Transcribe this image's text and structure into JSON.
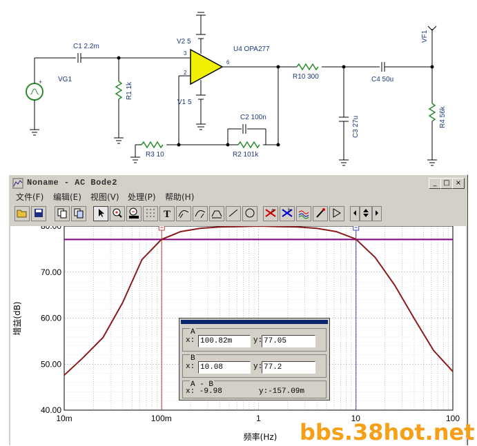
{
  "schematic": {
    "labels": {
      "vg1": "VG1",
      "c1": "C1 2.2m",
      "r1": "R1 1k",
      "v2": "V2 5",
      "v1": "V1 5",
      "u4": "U4 OPA277",
      "pin3": "3",
      "pin2": "2",
      "pin6": "6",
      "c2": "C2 100n",
      "r2": "R2 101k",
      "r3": "R3 10",
      "r10": "R10 300",
      "c3": "C3 27u",
      "c4": "C4 50u",
      "r4": "R4 56k",
      "vf1": "VF1",
      "plus": "+"
    }
  },
  "window": {
    "title": "Noname - AC Bode2",
    "buttons": {
      "minimize": "_",
      "maximize": "□",
      "close": "×"
    },
    "menus": [
      "文件(F)",
      "编辑(E)",
      "视图(V)",
      "处理(P)",
      "帮助(H)"
    ]
  },
  "toolbar": {
    "tools": [
      "open",
      "save",
      "copy",
      "copy-special",
      "pointer",
      "zoom-in",
      "zoom-100",
      "grid",
      "text",
      "cursor-a",
      "cursor-b",
      "marker",
      "line",
      "circle",
      "cursor-a-x",
      "cursor-b-x",
      "curves",
      "pen",
      "flag",
      "arrow-left",
      "arrow-updown",
      "arrow-right"
    ]
  },
  "cursor_box": {
    "group_a": "A",
    "group_b": "B",
    "group_ab": "A - B",
    "x_label": "x:",
    "y_label": "y:",
    "a_x": "100.82m",
    "a_y": "77.05",
    "b_x": "10.08",
    "b_y": "77.2",
    "ab_x": "x: -9.98",
    "ab_y": "y:-157.09m"
  },
  "chart_data": {
    "type": "line",
    "xlabel": "频率(Hz)",
    "ylabel": "增益(dB)",
    "xscale": "log",
    "xlim": [
      0.01,
      100
    ],
    "ylim": [
      40,
      80
    ],
    "x_ticks": [
      "10m",
      "100m",
      "1",
      "10",
      "100"
    ],
    "y_ticks": [
      "80.00",
      "70.00",
      "60.00",
      "50.00",
      "40.00"
    ],
    "grid": true,
    "cursor_a": {
      "x": 0.1008,
      "y": 77.05
    },
    "cursor_b": {
      "x": 10.08,
      "y": 77.2
    },
    "hline_y": 77.1,
    "curve_color": "#8b1a1a",
    "series": [
      {
        "x": [
          0.01,
          0.0158,
          0.0251,
          0.0398,
          0.0631,
          0.1,
          0.158,
          0.251,
          0.398,
          0.631,
          1,
          1.585,
          2.512,
          3.981,
          6.31,
          10,
          15.85,
          25.12,
          39.81,
          63.1,
          100
        ],
        "values": [
          47.6,
          51.5,
          55.8,
          63.3,
          72.7,
          77.1,
          78.8,
          79.5,
          79.8,
          79.9,
          80.0,
          79.9,
          79.8,
          79.5,
          78.8,
          77.2,
          73.2,
          67.2,
          60.0,
          53.0,
          48.4
        ]
      }
    ]
  },
  "watermark": "bbs.38hot.net"
}
